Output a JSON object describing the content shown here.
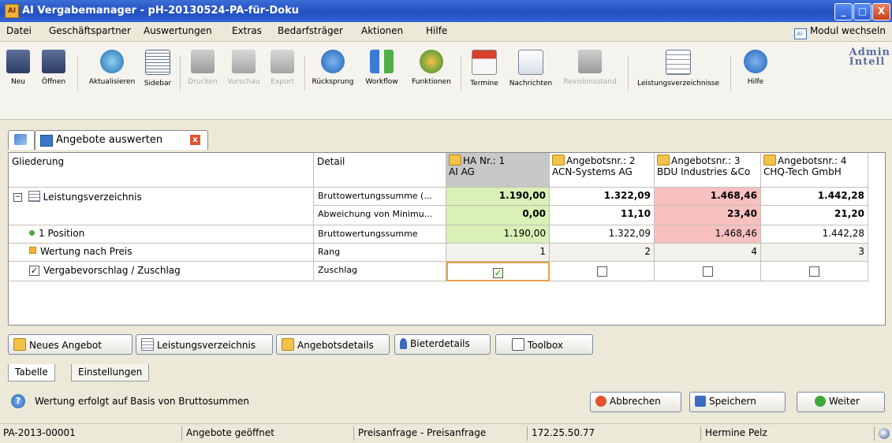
{
  "window": {
    "title": "AI Vergabemanager - pH-20130524-PA-für-Doku",
    "app_icon": "vergabemanager-icon",
    "controls": [
      "_",
      "□",
      "X"
    ]
  },
  "menu": {
    "items": [
      "Datei",
      "Geschäftspartner",
      "Auswertungen",
      "Extras",
      "Bedarfsträger",
      "Aktionen",
      "Hilfe"
    ],
    "module_switch": "Modul wechseln"
  },
  "toolbar": {
    "items": [
      {
        "label": "Neu",
        "icon": "new-document-icon",
        "enabled": true
      },
      {
        "label": "Öffnen",
        "icon": "open-document-icon",
        "enabled": true
      },
      {
        "label": "Aktualisieren",
        "icon": "refresh-icon",
        "enabled": true
      },
      {
        "label": "Sidebar",
        "icon": "sidebar-icon",
        "enabled": true
      },
      {
        "label": "Drucken",
        "icon": "printer-icon",
        "enabled": false
      },
      {
        "label": "Vorschau",
        "icon": "preview-icon",
        "enabled": false
      },
      {
        "label": "Export",
        "icon": "export-icon",
        "enabled": false
      },
      {
        "label": "Rücksprung",
        "icon": "back-arrow-icon",
        "enabled": true
      },
      {
        "label": "Workflow",
        "icon": "workflow-icon",
        "enabled": true
      },
      {
        "label": "Funktionen",
        "icon": "functions-icon",
        "enabled": true
      },
      {
        "label": "Termine",
        "icon": "calendar-icon",
        "enabled": true
      },
      {
        "label": "Nachrichten",
        "icon": "envelope-icon",
        "enabled": true
      },
      {
        "label": "Revisionsstand",
        "icon": "revision-icon",
        "enabled": false
      },
      {
        "label": "Leistungsverzeichnisse",
        "icon": "table-grid-icon",
        "enabled": true
      },
      {
        "label": "Hilfe",
        "icon": "help-icon",
        "enabled": true
      }
    ],
    "brand": [
      "Admin",
      "Intell"
    ]
  },
  "doc_tab": {
    "label": "Angebote auswerten"
  },
  "grid": {
    "headers": {
      "gliederung": "Gliederung",
      "detail": "Detail",
      "bidders": [
        {
          "line1": "HA Nr.: 1",
          "line2": "AI AG"
        },
        {
          "line1": "Angebotsnr.: 2",
          "line2": "ACN-Systems AG"
        },
        {
          "line1": "Angebotsnr.: 3",
          "line2": "BDU Industries &Co"
        },
        {
          "line1": "Angebotsnr.: 4",
          "line2": "CHQ-Tech GmbH"
        }
      ]
    },
    "rows": [
      {
        "label": "Leistungsverzeichnis",
        "detail": "Bruttowertungssumme (...",
        "values": [
          "1.190,00",
          "1.322,09",
          "1.468,46",
          "1.442,28"
        ]
      },
      {
        "label": "",
        "detail": "Abweichung von Minimu...",
        "values": [
          "0,00",
          "11,10",
          "23,40",
          "21,20"
        ]
      },
      {
        "label": "1 Position",
        "detail": "Bruttowertungssumme",
        "values": [
          "1.190,00",
          "1.322,09",
          "1.468,46",
          "1.442,28"
        ]
      },
      {
        "label": "Wertung nach Preis",
        "detail": "Rang",
        "values": [
          "1",
          "2",
          "4",
          "3"
        ]
      },
      {
        "label": "Vergabevorschlag / Zuschlag",
        "detail": "Zuschlag",
        "checked": [
          true,
          false,
          false,
          false
        ]
      }
    ],
    "colors": {
      "min": "#d9f0b6",
      "max": "#f9c0c0"
    }
  },
  "buttons": {
    "neues_angebot": "Neues Angebot",
    "leistungsverzeichnis": "Leistungsverzeichnis",
    "angebotsdetails": "Angebotsdetails",
    "bieterdetails": "Bieterdetails",
    "toolbox": "Toolbox"
  },
  "tabs": [
    "Tabelle",
    "Einstellungen"
  ],
  "footer": {
    "info": "Wertung erfolgt auf Basis von Bruttosummen",
    "abbrechen": "Abbrechen",
    "speichern": "Speichern",
    "weiter": "Weiter"
  },
  "status": {
    "id": "PA-2013-00001",
    "state": "Angebote geöffnet",
    "type": "Preisanfrage - Preisanfrage",
    "ip": "172.25.50.77",
    "user": "Hermine Pelz"
  }
}
